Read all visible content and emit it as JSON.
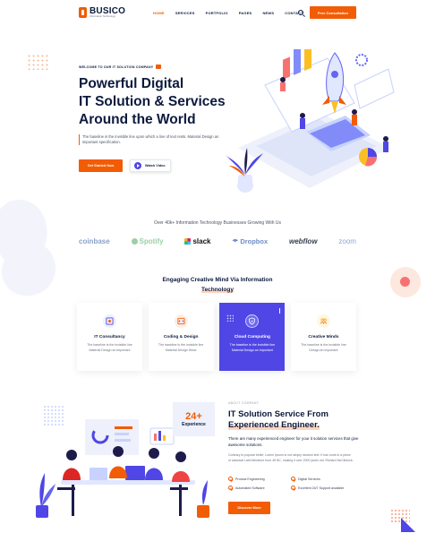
{
  "header": {
    "logo_name": "BUSICO",
    "logo_tagline": "Information Technology",
    "nav": [
      "HOME",
      "SERVICES",
      "PORTFOLIO",
      "PAGES",
      "NEWS",
      "CONTACT"
    ],
    "cta": "Free Consultation"
  },
  "hero": {
    "eyebrow": "WELCOME TO OUR IT SOLUTION COMPANY",
    "title_lines": [
      "Powerful Digital",
      "IT Solution & Services",
      "Around the World"
    ],
    "description": "The baseline is the invisible line upon which a line of text rests. Material Design an important specification.",
    "primary_button": "Get Started Now",
    "video_button": "Watch Video"
  },
  "brands": {
    "caption": "Over 40k+ Information Technology Businesses Growing With Us",
    "logos": [
      "coinbase",
      "Spotify",
      "slack",
      "Dropbox",
      "webflow",
      "zoom"
    ]
  },
  "services": {
    "title_line1": "Engaging Creative Mind Via Information",
    "title_line2": "Technology",
    "cards": [
      {
        "title": "IT Consultancy",
        "desc": "The baseline is the invisible line Material Design an important",
        "icon": "consultancy-icon"
      },
      {
        "title": "Coding & Design",
        "desc": "The baseline is the invisible line Material Design Www",
        "icon": "code-window-icon"
      },
      {
        "title": "Cloud Computing",
        "desc": "The baseline is the invisible line Material Design an important",
        "icon": "cloud-shield-icon"
      },
      {
        "title": "Creative Minds",
        "desc": "The baseline is the invisible line Design an important",
        "icon": "people-icon"
      }
    ]
  },
  "about": {
    "experience_number": "24+",
    "experience_label": "Experience",
    "eyebrow": "ABOUT COMPANY",
    "title_line1": "IT Solution Service From",
    "title_line2": "Experienced Engineer.",
    "lead": "There are many experienced engineer for your it solution services that give awesome solutions.",
    "body": "Contrary to popular belief, Lorem Ipsum is not simply random text. It has roots in a piece of classical Latin literature from 45 BC, making it over 2000 years old. Richard McClintock.",
    "features": [
      "Product Engineering",
      "Digital Services",
      "Automated Software",
      "Excellent 24/7 Support available"
    ],
    "button": "Discover More"
  },
  "colors": {
    "accent": "#f25c05",
    "primary": "#4f46e5",
    "heading": "#0c1a3d"
  }
}
